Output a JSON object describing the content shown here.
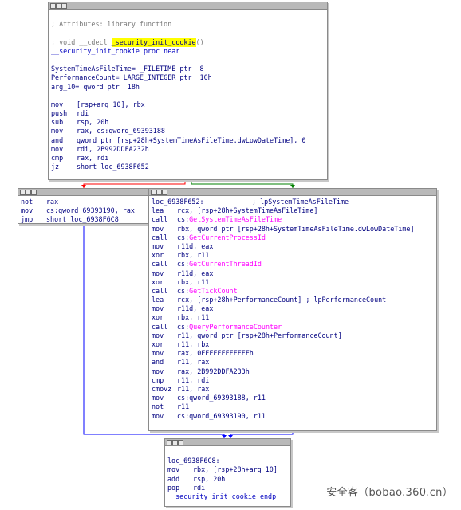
{
  "nodes": {
    "top": {
      "lines": [
        {
          "type": "blank"
        },
        {
          "type": "comment",
          "text": "; Attributes: library function"
        },
        {
          "type": "blank"
        },
        {
          "type": "proto",
          "prefix": "; void __cdecl ",
          "name": "_security_init_cookie",
          "suffix": "()"
        },
        {
          "type": "label",
          "text": "__security_init_cookie proc near"
        },
        {
          "type": "blank"
        },
        {
          "type": "raw",
          "text": "SystemTimeAsFileTime= _FILETIME ptr  8"
        },
        {
          "type": "raw",
          "text": "PerformanceCount= LARGE_INTEGER ptr  10h"
        },
        {
          "type": "raw",
          "text": "arg_10= qword ptr  18h"
        },
        {
          "type": "blank"
        },
        {
          "type": "ins",
          "mn": "mov",
          "ops": "[rsp+arg_10], rbx"
        },
        {
          "type": "ins",
          "mn": "push",
          "ops": "rdi"
        },
        {
          "type": "ins",
          "mn": "sub",
          "ops": "rsp, 20h"
        },
        {
          "type": "ins",
          "mn": "mov",
          "ops": "rax, cs:qword_69393188"
        },
        {
          "type": "ins",
          "mn": "and",
          "ops": "qword ptr [rsp+28h+SystemTimeAsFileTime.dwLowDateTime], 0"
        },
        {
          "type": "ins",
          "mn": "mov",
          "ops": "rdi, 2B992DDFA232h"
        },
        {
          "type": "ins",
          "mn": "cmp",
          "ops": "rax, rdi"
        },
        {
          "type": "ins",
          "mn": "jz",
          "ops": "short loc_6938F652"
        }
      ]
    },
    "left": {
      "lines": [
        {
          "type": "ins",
          "mn": "not",
          "ops": "rax"
        },
        {
          "type": "ins",
          "mn": "mov",
          "ops": "cs:qword_69393190, rax"
        },
        {
          "type": "ins",
          "mn": "jmp",
          "ops": "short loc_6938F6C8"
        }
      ]
    },
    "right": {
      "lines": [
        {
          "type": "raw",
          "text": "loc_6938F652:            ; lpSystemTimeAsFileTime"
        },
        {
          "type": "ins",
          "mn": "lea",
          "ops": "rcx, [rsp+28h+SystemTimeAsFileTime]"
        },
        {
          "type": "call",
          "mn": "call",
          "pre": "cs:",
          "fn": "GetSystemTimeAsFileTime"
        },
        {
          "type": "ins",
          "mn": "mov",
          "ops": "rbx, qword ptr [rsp+28h+SystemTimeAsFileTime.dwLowDateTime]"
        },
        {
          "type": "call",
          "mn": "call",
          "pre": "cs:",
          "fn": "GetCurrentProcessId"
        },
        {
          "type": "ins",
          "mn": "mov",
          "ops": "r11d, eax"
        },
        {
          "type": "ins",
          "mn": "xor",
          "ops": "rbx, r11"
        },
        {
          "type": "call",
          "mn": "call",
          "pre": "cs:",
          "fn": "GetCurrentThreadId"
        },
        {
          "type": "ins",
          "mn": "mov",
          "ops": "r11d, eax"
        },
        {
          "type": "ins",
          "mn": "xor",
          "ops": "rbx, r11"
        },
        {
          "type": "call",
          "mn": "call",
          "pre": "cs:",
          "fn": "GetTickCount"
        },
        {
          "type": "ins",
          "mn": "lea",
          "ops": "rcx, [rsp+28h+PerformanceCount] ; lpPerformanceCount"
        },
        {
          "type": "ins",
          "mn": "mov",
          "ops": "r11d, eax"
        },
        {
          "type": "ins",
          "mn": "xor",
          "ops": "rbx, r11"
        },
        {
          "type": "call",
          "mn": "call",
          "pre": "cs:",
          "fn": "QueryPerformanceCounter"
        },
        {
          "type": "ins",
          "mn": "mov",
          "ops": "r11, qword ptr [rsp+28h+PerformanceCount]"
        },
        {
          "type": "ins",
          "mn": "xor",
          "ops": "r11, rbx"
        },
        {
          "type": "ins",
          "mn": "mov",
          "ops": "rax, 0FFFFFFFFFFFFh"
        },
        {
          "type": "ins",
          "mn": "and",
          "ops": "r11, rax"
        },
        {
          "type": "ins",
          "mn": "mov",
          "ops": "rax, 2B992DDFA233h"
        },
        {
          "type": "ins",
          "mn": "cmp",
          "ops": "r11, rdi"
        },
        {
          "type": "ins",
          "mn": "cmovz",
          "ops": "r11, rax"
        },
        {
          "type": "ins",
          "mn": "mov",
          "ops": "cs:qword_69393188, r11"
        },
        {
          "type": "ins",
          "mn": "not",
          "ops": "r11"
        },
        {
          "type": "ins",
          "mn": "mov",
          "ops": "cs:qword_69393190, r11"
        }
      ]
    },
    "bottom": {
      "lines": [
        {
          "type": "blank"
        },
        {
          "type": "raw",
          "text": "loc_6938F6C8:"
        },
        {
          "type": "ins",
          "mn": "mov",
          "ops": "rbx, [rsp+28h+arg_10]"
        },
        {
          "type": "ins",
          "mn": "add",
          "ops": "rsp, 20h"
        },
        {
          "type": "ins",
          "mn": "pop",
          "ops": "rdi"
        },
        {
          "type": "label",
          "text": "__security_init_cookie endp"
        }
      ]
    }
  },
  "colors": {
    "edge_true": "#008000",
    "edge_false": "#ff0000",
    "edge_uncond": "#0000ff",
    "highlight": "#ffff00",
    "api_call": "#ff00ff"
  },
  "watermark": "安全客（bobao.360.cn）"
}
